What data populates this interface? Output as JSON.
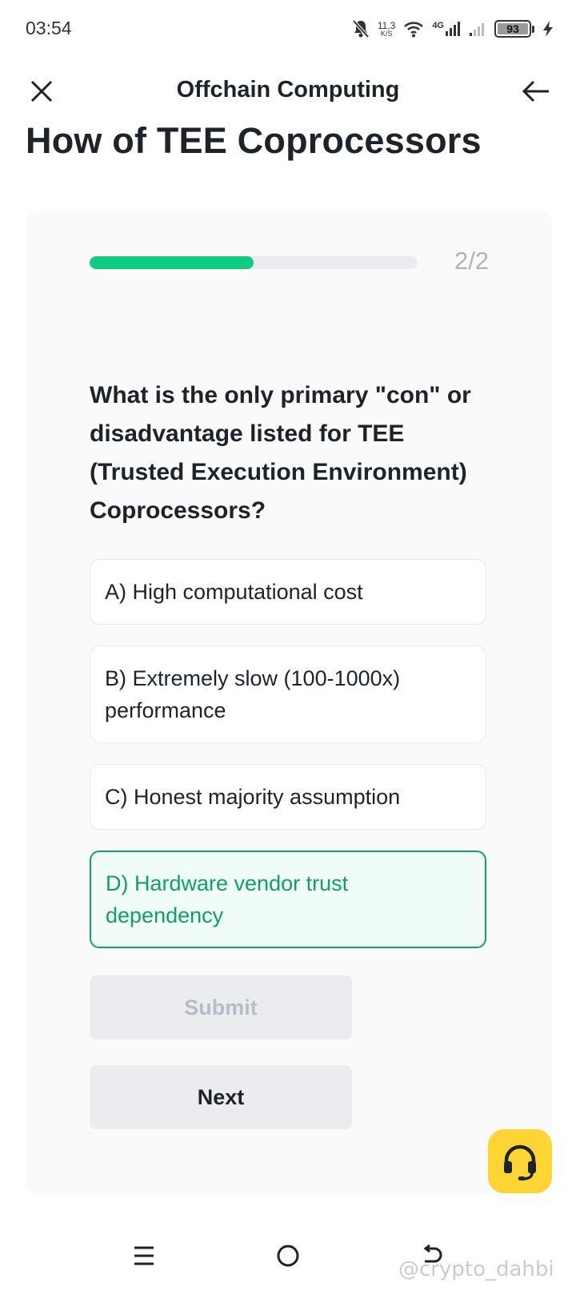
{
  "status_bar": {
    "time": "03:54",
    "net_speed": "11,3",
    "net_unit": "K/S",
    "network": "4G",
    "battery": "93"
  },
  "header": {
    "title": "Offchain Computing"
  },
  "page_title": "How of TEE Coprocessors",
  "quiz": {
    "progress_fraction": 0.5,
    "progress_label": "2/2",
    "question": "What is the only primary \"con\" or disadvantage listed for TEE (Trusted Execution Environment) Coprocessors?",
    "options": [
      {
        "label": "A) High computational cost",
        "selected": false
      },
      {
        "label": "B) Extremely slow (100-1000x) performance",
        "selected": false
      },
      {
        "label": "C) Honest majority assumption",
        "selected": false
      },
      {
        "label": "D) Hardware vendor trust dependency",
        "selected": true
      }
    ],
    "submit_label": "Submit",
    "next_label": "Next"
  },
  "watermark": "@crypto_dahbi",
  "colors": {
    "accent_green": "#0ecb81",
    "selected_green": "#129e6b",
    "fab_yellow": "#fcd535"
  },
  "icons": {
    "close": "close-icon",
    "back": "arrow-left-icon",
    "support": "headset-icon",
    "nav_menu": "menu-icon",
    "nav_home": "home-circle-icon",
    "nav_back": "nav-back-icon"
  }
}
